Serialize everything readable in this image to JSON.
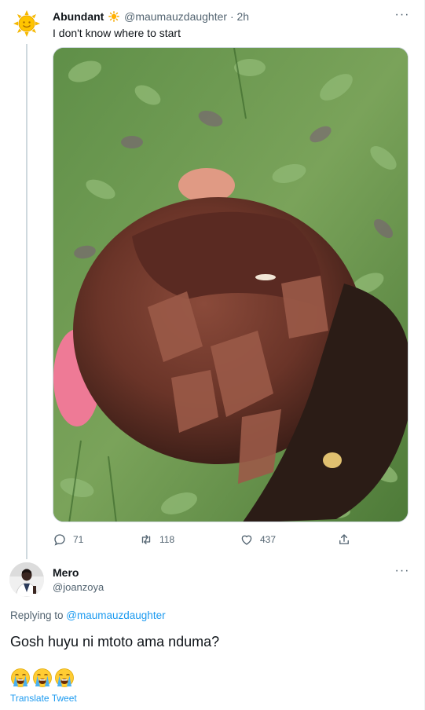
{
  "tweet": {
    "author_name": "Abundant",
    "author_emoji": "sun-emoji",
    "handle": "@maumauzdaughter",
    "separator": "·",
    "time": "2h",
    "more_label": "···",
    "text": "I don't know where to start",
    "stats": {
      "replies": "71",
      "retweets": "118",
      "likes": "437"
    }
  },
  "reply": {
    "author_name": "Mero",
    "handle": "@joanzoya",
    "more_label": "···",
    "replying_prefix": "Replying to ",
    "replying_to": "@maumauzdaughter",
    "text": "Gosh huyu ni mtoto ama nduma?",
    "emojis": [
      "loudly-crying-face",
      "loudly-crying-face",
      "loudly-crying-face"
    ],
    "translate_label": "Translate Tweet"
  },
  "colors": {
    "accent": "#1d9bf0",
    "secondary_text": "#536471",
    "primary_text": "#0f1419"
  }
}
